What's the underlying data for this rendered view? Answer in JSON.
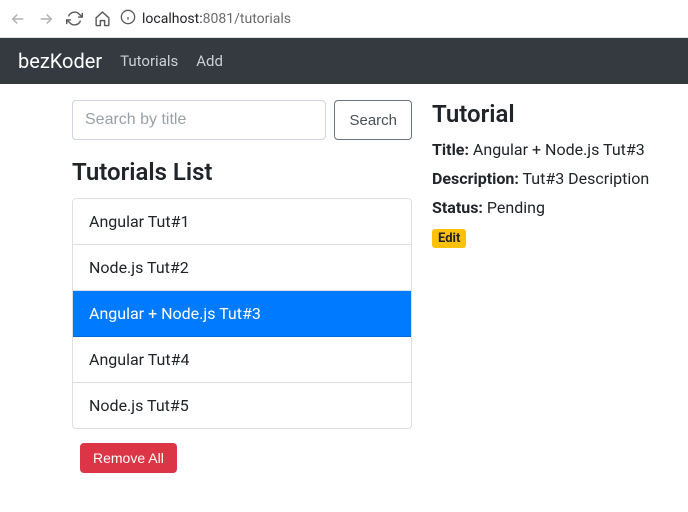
{
  "browser": {
    "url_host": "localhost:",
    "url_port": "8081",
    "url_path": "/tutorials"
  },
  "nav": {
    "brand": "bezKoder",
    "links": [
      "Tutorials",
      "Add"
    ]
  },
  "search": {
    "placeholder": "Search by title",
    "button": "Search"
  },
  "list": {
    "heading": "Tutorials List",
    "items": [
      "Angular Tut#1",
      "Node.js Tut#2",
      "Angular + Node.js Tut#3",
      "Angular Tut#4",
      "Node.js Tut#5"
    ],
    "active_index": 2,
    "remove_all": "Remove All"
  },
  "detail": {
    "heading": "Tutorial",
    "title_label": "Title:",
    "title_value": "Angular + Node.js Tut#3",
    "desc_label": "Description:",
    "desc_value": "Tut#3 Description",
    "status_label": "Status:",
    "status_value": "Pending",
    "edit": "Edit"
  }
}
